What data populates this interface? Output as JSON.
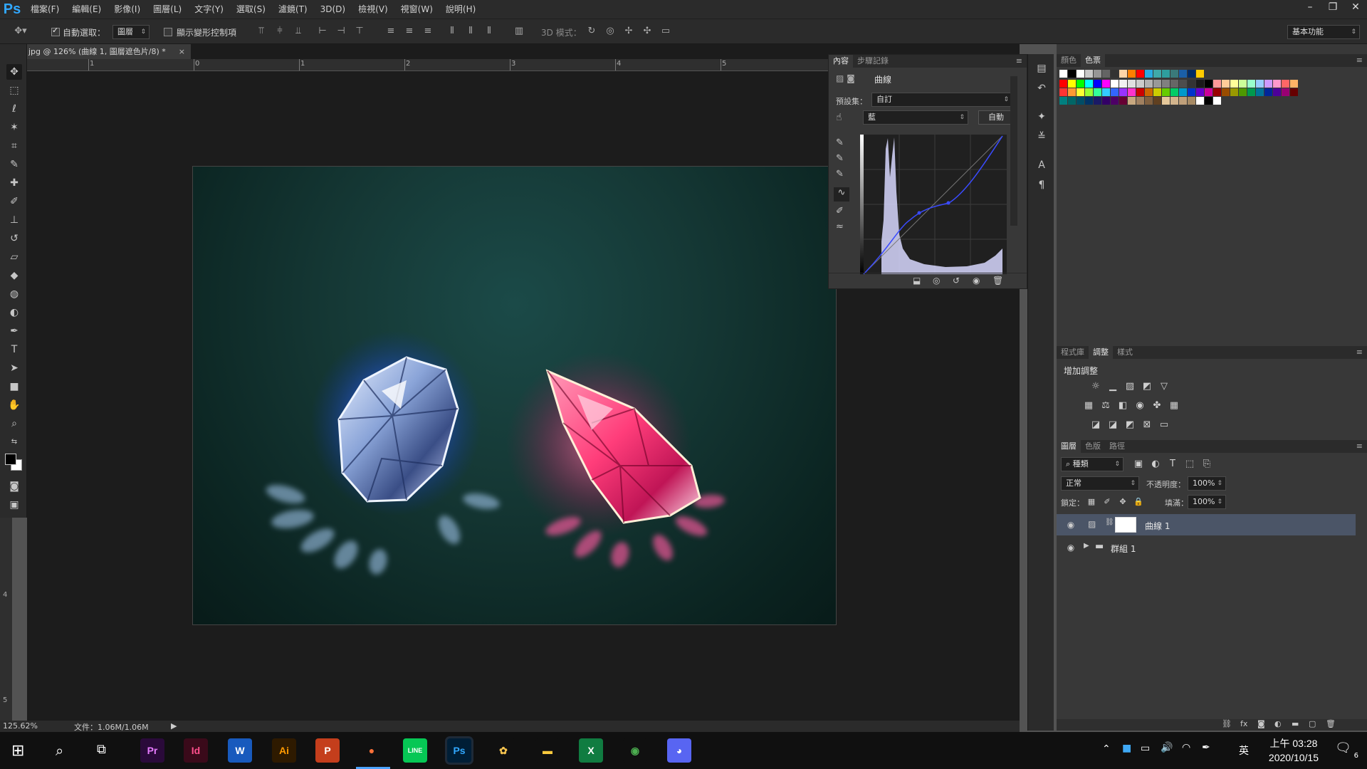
{
  "menubar": {
    "logo": "Ps",
    "items": [
      "檔案(F)",
      "編輯(E)",
      "影像(I)",
      "圖層(L)",
      "文字(Y)",
      "選取(S)",
      "濾鏡(T)",
      "3D(D)",
      "檢視(V)",
      "視窗(W)",
      "說明(H)"
    ],
    "window_controls": [
      "–",
      "❐",
      "✕"
    ]
  },
  "optbar": {
    "auto_select_label": "自動選取：",
    "auto_select_value": "圖層",
    "show_transform_label": "顯示變形控制項",
    "mode_3d_label": "3D 模式：",
    "workspace": "基本功能"
  },
  "document": {
    "tab_title": "jpg @ 126% (曲線 1, 圖層遮色片/8) *",
    "tab_close": "×",
    "ruler_top": [
      "1",
      "0",
      "1",
      "2",
      "3",
      "4",
      "5"
    ],
    "ruler_left": [
      "4",
      "5"
    ]
  },
  "properties": {
    "tabs": [
      "內容",
      "步驟記錄"
    ],
    "title": "曲線",
    "preset_label": "預設集：",
    "preset_value": "自訂",
    "channel_value": "藍",
    "auto_button": "自動"
  },
  "right_panels": {
    "color_tabs": [
      "顏色",
      "色票"
    ],
    "adj_tabs": [
      "程式庫",
      "調整",
      "樣式"
    ],
    "adj_title": "增加調整",
    "layer_tabs": [
      "圖層",
      "色版",
      "路徑"
    ],
    "layer_filter": "種類",
    "blend_mode": "正常",
    "opacity_label": "不透明度：",
    "opacity_value": "100%",
    "lock_label": "鎖定：",
    "fill_label": "填滿：",
    "fill_value": "100%",
    "layers": [
      {
        "name": "曲線 1",
        "selected": true
      },
      {
        "name": "群組 1",
        "selected": false
      }
    ]
  },
  "statusbar": {
    "zoom": "125.62%",
    "doc_info": "文件：1.06M/1.06M"
  },
  "taskbar": {
    "apps": [
      {
        "label": "Pr",
        "bg": "#2a0a3a",
        "fg": "#e77cff"
      },
      {
        "label": "Id",
        "bg": "#3a0a1a",
        "fg": "#ff4f8c"
      },
      {
        "label": "W",
        "bg": "#185abd",
        "fg": "#ffffff"
      },
      {
        "label": "Ai",
        "bg": "#2e1a00",
        "fg": "#ff9a00"
      },
      {
        "label": "P",
        "bg": "#c43e1c",
        "fg": "#ffffff"
      },
      {
        "label": "●",
        "bg": "#101010",
        "fg": "#ff7139"
      },
      {
        "label": "LINE",
        "bg": "#06c755",
        "fg": "#ffffff"
      },
      {
        "label": "Ps",
        "bg": "#001e36",
        "fg": "#31a8ff"
      },
      {
        "label": "✿",
        "bg": "#101010",
        "fg": "#f2c14e"
      },
      {
        "label": "▬",
        "bg": "#101010",
        "fg": "#f8c93d"
      },
      {
        "label": "X",
        "bg": "#107c41",
        "fg": "#ffffff"
      },
      {
        "label": "◉",
        "bg": "#101010",
        "fg": "#4caf50"
      },
      {
        "label": "◕",
        "bg": "#5865f2",
        "fg": "#ffffff"
      }
    ],
    "ime": "英",
    "time": "上午 03:28",
    "date": "2020/10/15",
    "notification_count": "6"
  }
}
